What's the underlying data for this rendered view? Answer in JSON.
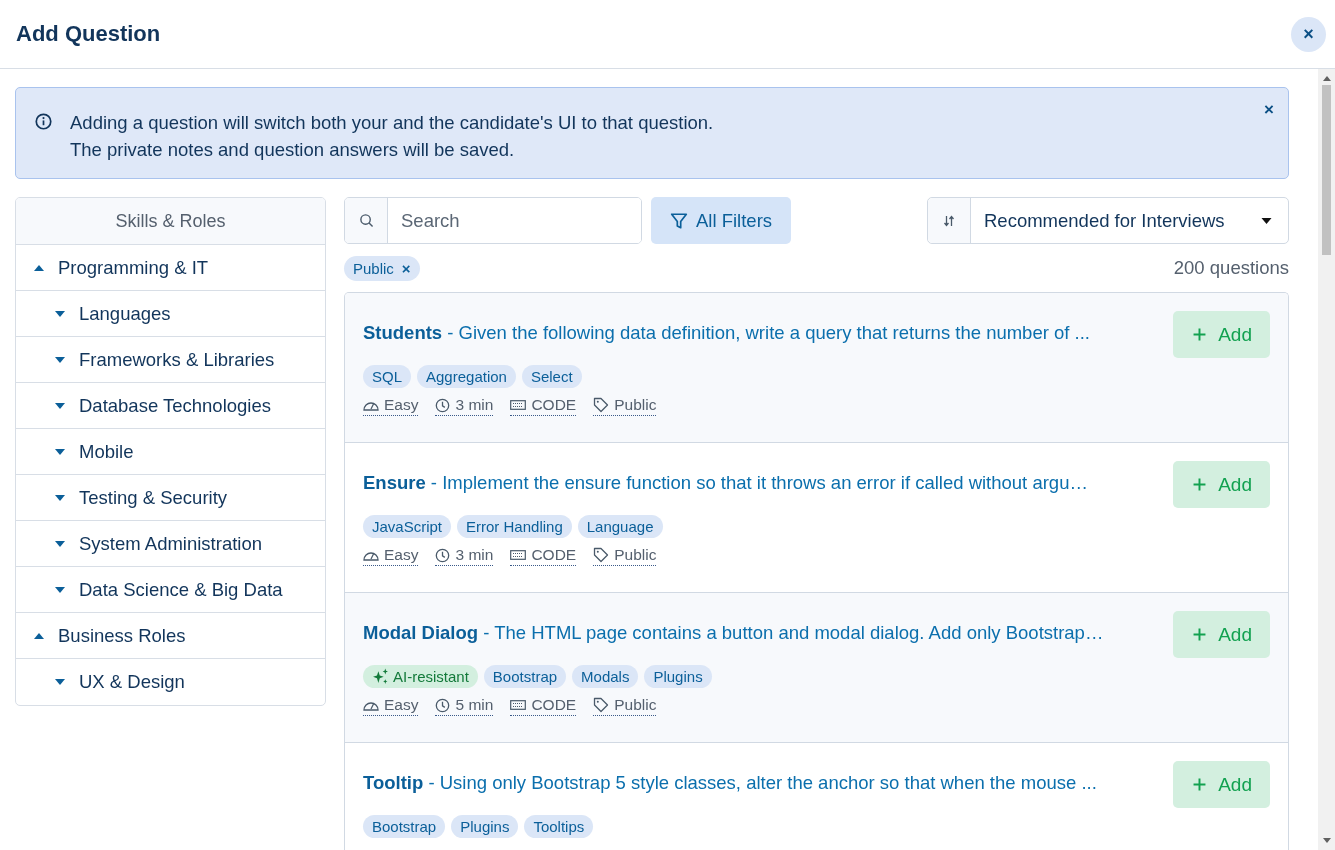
{
  "dialog": {
    "title": "Add Question",
    "close": "×"
  },
  "notice": {
    "lines": [
      "Adding a question will switch both your and the candidate's UI to that question.",
      "The private notes and question answers will be saved."
    ],
    "close": "×"
  },
  "sidebar": {
    "heading": "Skills & Roles",
    "items": [
      {
        "label": "Programming & IT",
        "expanded": true,
        "children": [
          {
            "label": "Languages",
            "expanded": false
          },
          {
            "label": "Frameworks & Libraries",
            "expanded": false
          },
          {
            "label": "Database Technologies",
            "expanded": false
          },
          {
            "label": "Mobile",
            "expanded": false
          },
          {
            "label": "Testing & Security",
            "expanded": false
          },
          {
            "label": "System Administration",
            "expanded": false
          },
          {
            "label": "Data Science & Big Data",
            "expanded": false
          }
        ]
      },
      {
        "label": "Business Roles",
        "expanded": true,
        "children": [
          {
            "label": "UX & Design",
            "expanded": false
          }
        ]
      }
    ]
  },
  "toolbar": {
    "search": {
      "placeholder": "Search"
    },
    "filters_button": "All Filters",
    "sort": "Recommended for Interviews"
  },
  "active_filters": [
    {
      "label": "Public",
      "remove": "×"
    }
  ],
  "count": "200 questions",
  "questions": [
    {
      "title": "Students",
      "description": "- Given the following data definition, write a query that returns the number of ...",
      "add": "Add",
      "tags": [
        {
          "label": "SQL",
          "kind": "plain"
        },
        {
          "label": "Aggregation",
          "kind": "plain"
        },
        {
          "label": "Select",
          "kind": "plain"
        }
      ],
      "meta": {
        "difficulty": "Easy",
        "time": "3 min",
        "type": "CODE",
        "visibility": "Public"
      }
    },
    {
      "title": "Ensure",
      "description": "- Implement the ensure function so that it throws an error if called without argu…",
      "add": "Add",
      "tags": [
        {
          "label": "JavaScript",
          "kind": "plain"
        },
        {
          "label": "Error Handling",
          "kind": "plain"
        },
        {
          "label": "Language",
          "kind": "plain"
        }
      ],
      "meta": {
        "difficulty": "Easy",
        "time": "3 min",
        "type": "CODE",
        "visibility": "Public"
      }
    },
    {
      "title": "Modal Dialog",
      "description": "- The HTML page contains a button and modal dialog. Add only Bootstrap…",
      "add": "Add",
      "tags": [
        {
          "label": "AI-resistant",
          "kind": "ai"
        },
        {
          "label": "Bootstrap",
          "kind": "plain"
        },
        {
          "label": "Modals",
          "kind": "plain"
        },
        {
          "label": "Plugins",
          "kind": "plain"
        }
      ],
      "meta": {
        "difficulty": "Easy",
        "time": "5 min",
        "type": "CODE",
        "visibility": "Public"
      }
    },
    {
      "title": "Tooltip",
      "description": "- Using only Bootstrap 5 style classes, alter the anchor so that when the mouse ...",
      "add": "Add",
      "tags": [
        {
          "label": "Bootstrap",
          "kind": "plain"
        },
        {
          "label": "Plugins",
          "kind": "plain"
        },
        {
          "label": "Tooltips",
          "kind": "plain"
        }
      ]
    }
  ]
}
